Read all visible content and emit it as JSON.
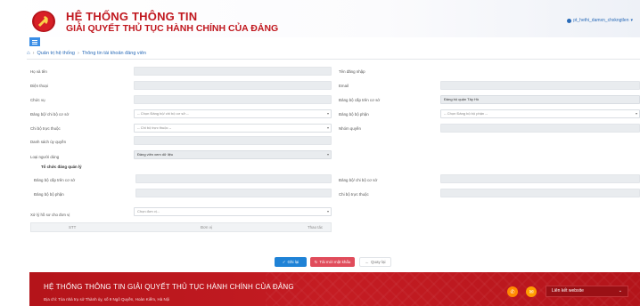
{
  "header": {
    "title_line1": "HỆ THỐNG THÔNG TIN",
    "title_line2": "GIẢI QUYẾT THỦ TỤC HÀNH CHÍNH CỦA ĐẢNG",
    "user": "pt_hethi_damxn_chxkngtlen"
  },
  "breadcrumb": {
    "level1": "Quản trị hệ thống",
    "level2": "Thông tin tài khoản đảng viên"
  },
  "form": {
    "left": {
      "fullname_label": "Họ và tên",
      "phone_label": "Điện thoại",
      "position_label": "Chức vụ",
      "party_org_label": "Đảng bộ/ chi bộ cơ sở",
      "party_org_placeholder": "-- Chọn Đảng bộ/ chi bộ cơ sở --",
      "sub_branch_label": "Chi bộ trực thuộc",
      "sub_branch_placeholder": "-- Chi bộ trực thuộc --",
      "delegation_label": "Danh sách ủy quyền",
      "user_type_label": "Loại người dùng",
      "user_type_value": "Đảng viên xem dữ liệu"
    },
    "right": {
      "login_label": "Tên đăng nhập",
      "email_label": "Email",
      "upper_org_label": "Đảng bộ cấp trên cơ sở",
      "upper_org_value": "Đảng bộ quận Tây Hồ",
      "dept_label": "Đảng bộ bộ phận",
      "dept_placeholder": "-- Chọn Đảng bộ bộ phận --",
      "group_label": "Nhóm quyền"
    },
    "section": {
      "title": "Tổ chức đảng quản lý",
      "upper_org_label": "Đảng bộ cấp trên cơ sở",
      "base_org_label": "Đảng bộ/ chi bộ cơ sở",
      "dept_label": "Đảng bộ bộ phận",
      "sub_branch_label": "Chi bộ trực thuộc"
    },
    "unit": {
      "label": "Xử lý hồ sơ cho đơn vị",
      "placeholder": "Chọn đơn vị..."
    },
    "table": {
      "col_stt": "STT",
      "col_unit": "Đơn vị",
      "col_action": "Thao tác"
    }
  },
  "buttons": {
    "save": "Ghi lại",
    "reset": "Tải mới mật khẩu",
    "back": "Quay lại"
  },
  "footer": {
    "title": "HỆ THỐNG THÔNG TIN GIẢI QUYẾT THỦ TỤC HÀNH CHÍNH CỦA ĐẢNG",
    "address": "Địa chỉ: Tòa nhà trụ sở Thành ủy, số 9 Ngô Quyền, Hoàn Kiếm, Hà Nội",
    "links_label": "Liên kết website"
  },
  "colors": {
    "brand_red": "#c0171e",
    "primary_blue": "#1f82d6",
    "danger": "#e04c5b"
  }
}
